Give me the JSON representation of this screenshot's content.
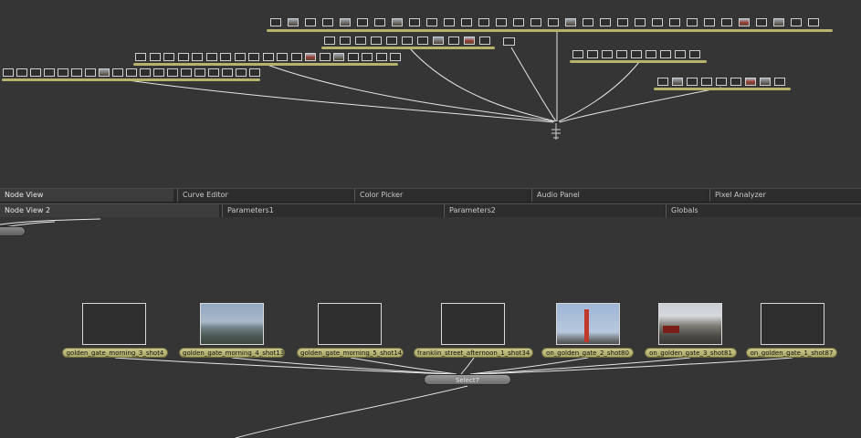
{
  "tabs_row_1": [
    {
      "label": "Node View",
      "active": true
    },
    {
      "label": "Curve Editor",
      "active": false
    },
    {
      "label": "Color Picker",
      "active": false
    },
    {
      "label": "Audio Panel",
      "active": false
    },
    {
      "label": "Pixel Analyzer",
      "active": false
    }
  ],
  "tabs_row_2": [
    {
      "label": "Node View 2",
      "active": true
    },
    {
      "label": "Parameters1",
      "active": false
    },
    {
      "label": "Parameters2",
      "active": false
    },
    {
      "label": "Globals",
      "active": false
    }
  ],
  "source_nodes": [
    {
      "label": "golden_gate_morning_3_shot4",
      "thumbnail": "empty"
    },
    {
      "label": "golden_gate_morning_4_shot13",
      "thumbnail": "bay-view"
    },
    {
      "label": "golden_gate_morning_5_shot14",
      "thumbnail": "empty"
    },
    {
      "label": "franklin_street_afternoon_1_shot34",
      "thumbnail": "empty"
    },
    {
      "label": "on_golden_gate_2_shot80",
      "thumbnail": "bridge-tower"
    },
    {
      "label": "on_golden_gate_3_shot81",
      "thumbnail": "road-traffic"
    },
    {
      "label": "on_golden_gate_1_shot87",
      "thumbnail": "empty"
    }
  ],
  "select_node": {
    "label": "Select7"
  },
  "colors": {
    "background": "#353535",
    "tab_bar": "#2a2a2a",
    "node_label": "#b7b36e",
    "wire": "#e8e8e8"
  }
}
